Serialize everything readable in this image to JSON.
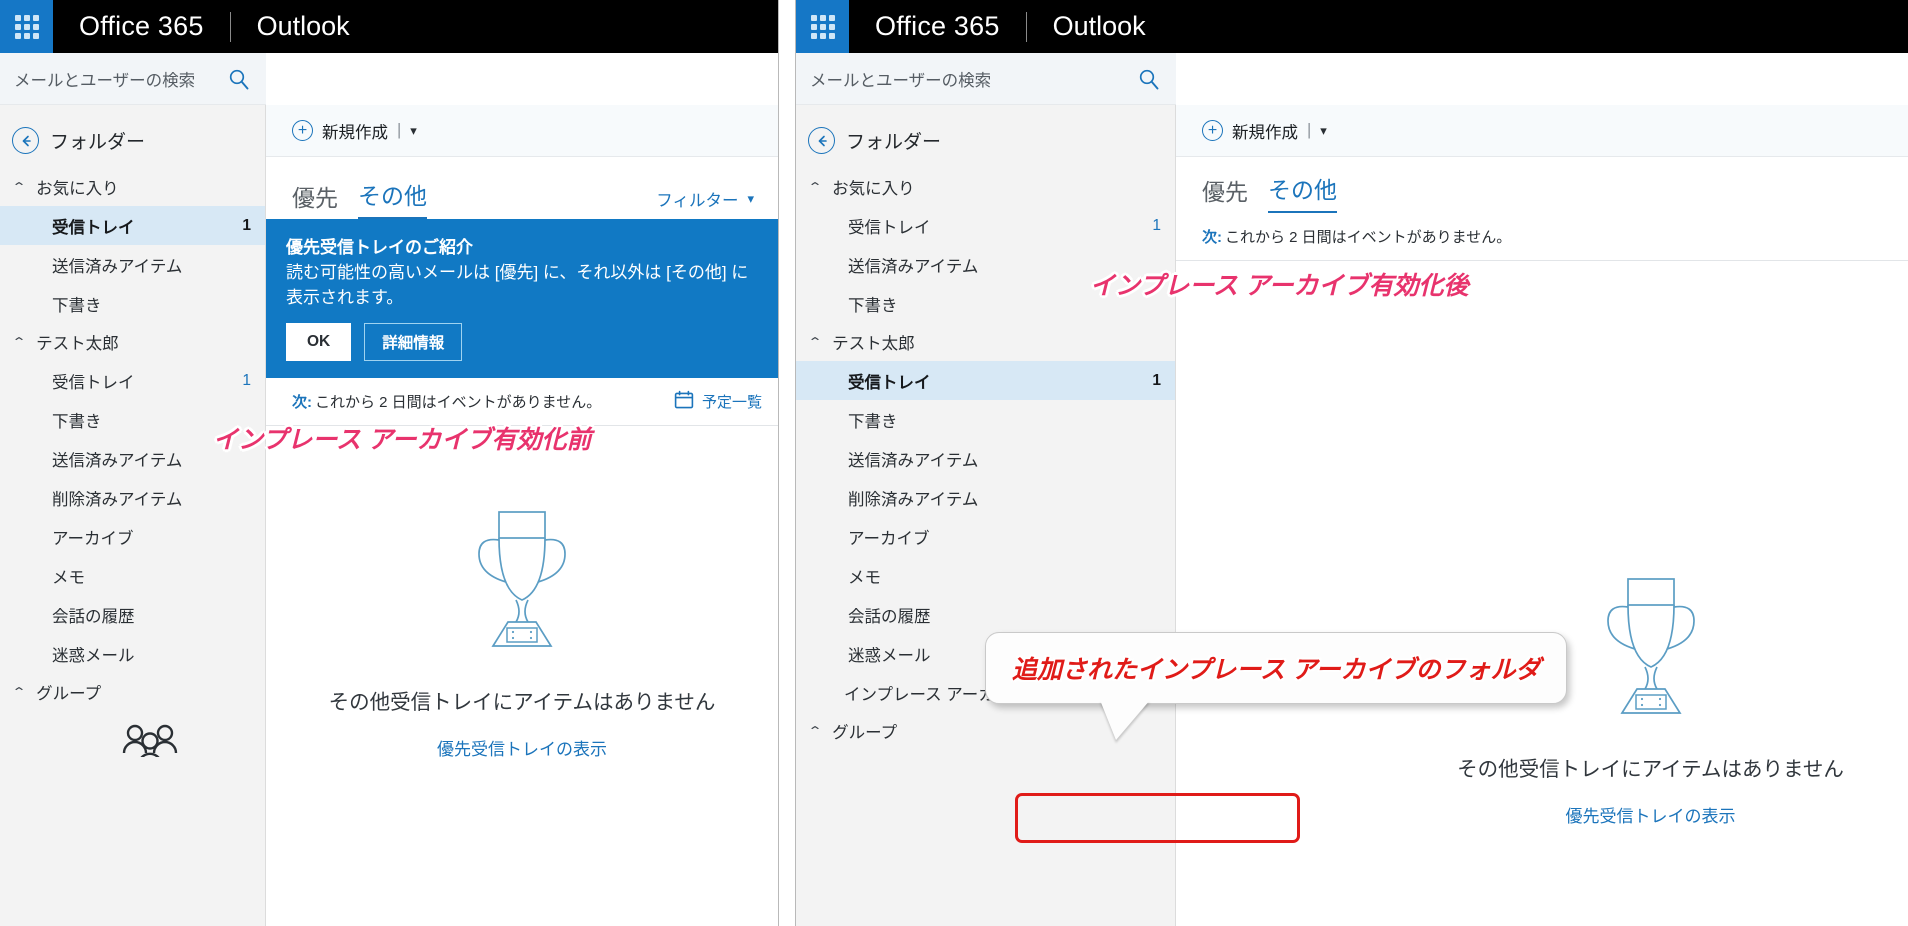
{
  "header": {
    "waffle_icon": "app-launcher-waffle-icon",
    "brand": "Office 365",
    "app_name": "Outlook"
  },
  "search": {
    "placeholder": "メールとユーザーの検索",
    "icon": "search-icon"
  },
  "nav": {
    "back_icon": "back-arrow-icon",
    "title": "フォルダー",
    "groups": [
      {
        "label": "お気に入り",
        "items": [
          {
            "label": "受信トレイ",
            "count": "1",
            "selected": true
          },
          {
            "label": "送信済みアイテム",
            "count": "",
            "selected": false
          },
          {
            "label": "下書き",
            "count": "",
            "selected": false
          }
        ]
      },
      {
        "label": "テスト太郎",
        "items": [
          {
            "label": "受信トレイ",
            "count": "1",
            "selected": false
          },
          {
            "label": "下書き",
            "count": "",
            "selected": false
          },
          {
            "label": "送信済みアイテム",
            "count": "",
            "selected": false
          },
          {
            "label": "削除済みアイテム",
            "count": "",
            "selected": false
          },
          {
            "label": "アーカイブ",
            "count": "",
            "selected": false
          },
          {
            "label": "メモ",
            "count": "",
            "selected": false
          },
          {
            "label": "会話の履歴",
            "count": "",
            "selected": false
          },
          {
            "label": "迷惑メール",
            "count": "",
            "selected": false
          }
        ]
      },
      {
        "label": "グループ",
        "items": []
      }
    ],
    "people_icon": "people-group-icon"
  },
  "nav_right": {
    "back_icon": "back-arrow-icon",
    "title": "フォルダー",
    "groups": [
      {
        "label": "お気に入り",
        "items": [
          {
            "label": "受信トレイ",
            "count": "1",
            "selected": false
          },
          {
            "label": "送信済みアイテム",
            "count": "",
            "selected": false
          },
          {
            "label": "下書き",
            "count": "",
            "selected": false
          }
        ]
      },
      {
        "label": "テスト太郎",
        "items": [
          {
            "label": "受信トレイ",
            "count": "1",
            "selected": true
          },
          {
            "label": "下書き",
            "count": "",
            "selected": false
          },
          {
            "label": "送信済みアイテム",
            "count": "",
            "selected": false
          },
          {
            "label": "削除済みアイテム",
            "count": "",
            "selected": false
          },
          {
            "label": "アーカイブ",
            "count": "",
            "selected": false
          },
          {
            "label": "メモ",
            "count": "",
            "selected": false
          },
          {
            "label": "会話の履歴",
            "count": "",
            "selected": false
          },
          {
            "label": "迷惑メール",
            "count": "",
            "selected": false
          },
          {
            "label": "インプレース アーカイブ -テスト太郎",
            "count": "",
            "selected": false,
            "highlighted": true
          }
        ]
      },
      {
        "label": "グループ",
        "items": []
      }
    ]
  },
  "toolbar": {
    "new_icon": "plus-circle-icon",
    "new_label": "新規作成",
    "separator": "|",
    "caret_icon": "chevron-down-icon"
  },
  "tabs": {
    "focused": "優先",
    "other": "その他",
    "filter_label": "フィルター",
    "filter_label_clipped": "フィル",
    "filter_caret_icon": "chevron-down-icon"
  },
  "banner": {
    "title": "優先受信トレイのご紹介",
    "body": "読む可能性の高いメールは [優先] に、それ以外は [その他] に表示されます。",
    "ok_label": "OK",
    "more_label": "詳細情報",
    "bg_color": "#1179c4"
  },
  "event_bar": {
    "prefix": "次:",
    "text": "これから 2 日間はイベントがありません。",
    "calendar_icon": "calendar-icon",
    "agenda_label": "予定一覧",
    "agenda_label_clipped": "予"
  },
  "empty_state": {
    "trophy_icon": "trophy-icon",
    "message": "その他受信トレイにアイテムはありません",
    "message_clipped": "その他受信トレイにアイテムはありませ",
    "link": "優先受信トレイの表示"
  },
  "annotations": {
    "before": "インプレース アーカイブ有効化前",
    "after": "インプレース アーカイブ有効化後",
    "callout": "追加されたインプレース アーカイブのフォルダ",
    "pink_color": "#e8336d",
    "red_color": "#e01b18"
  }
}
